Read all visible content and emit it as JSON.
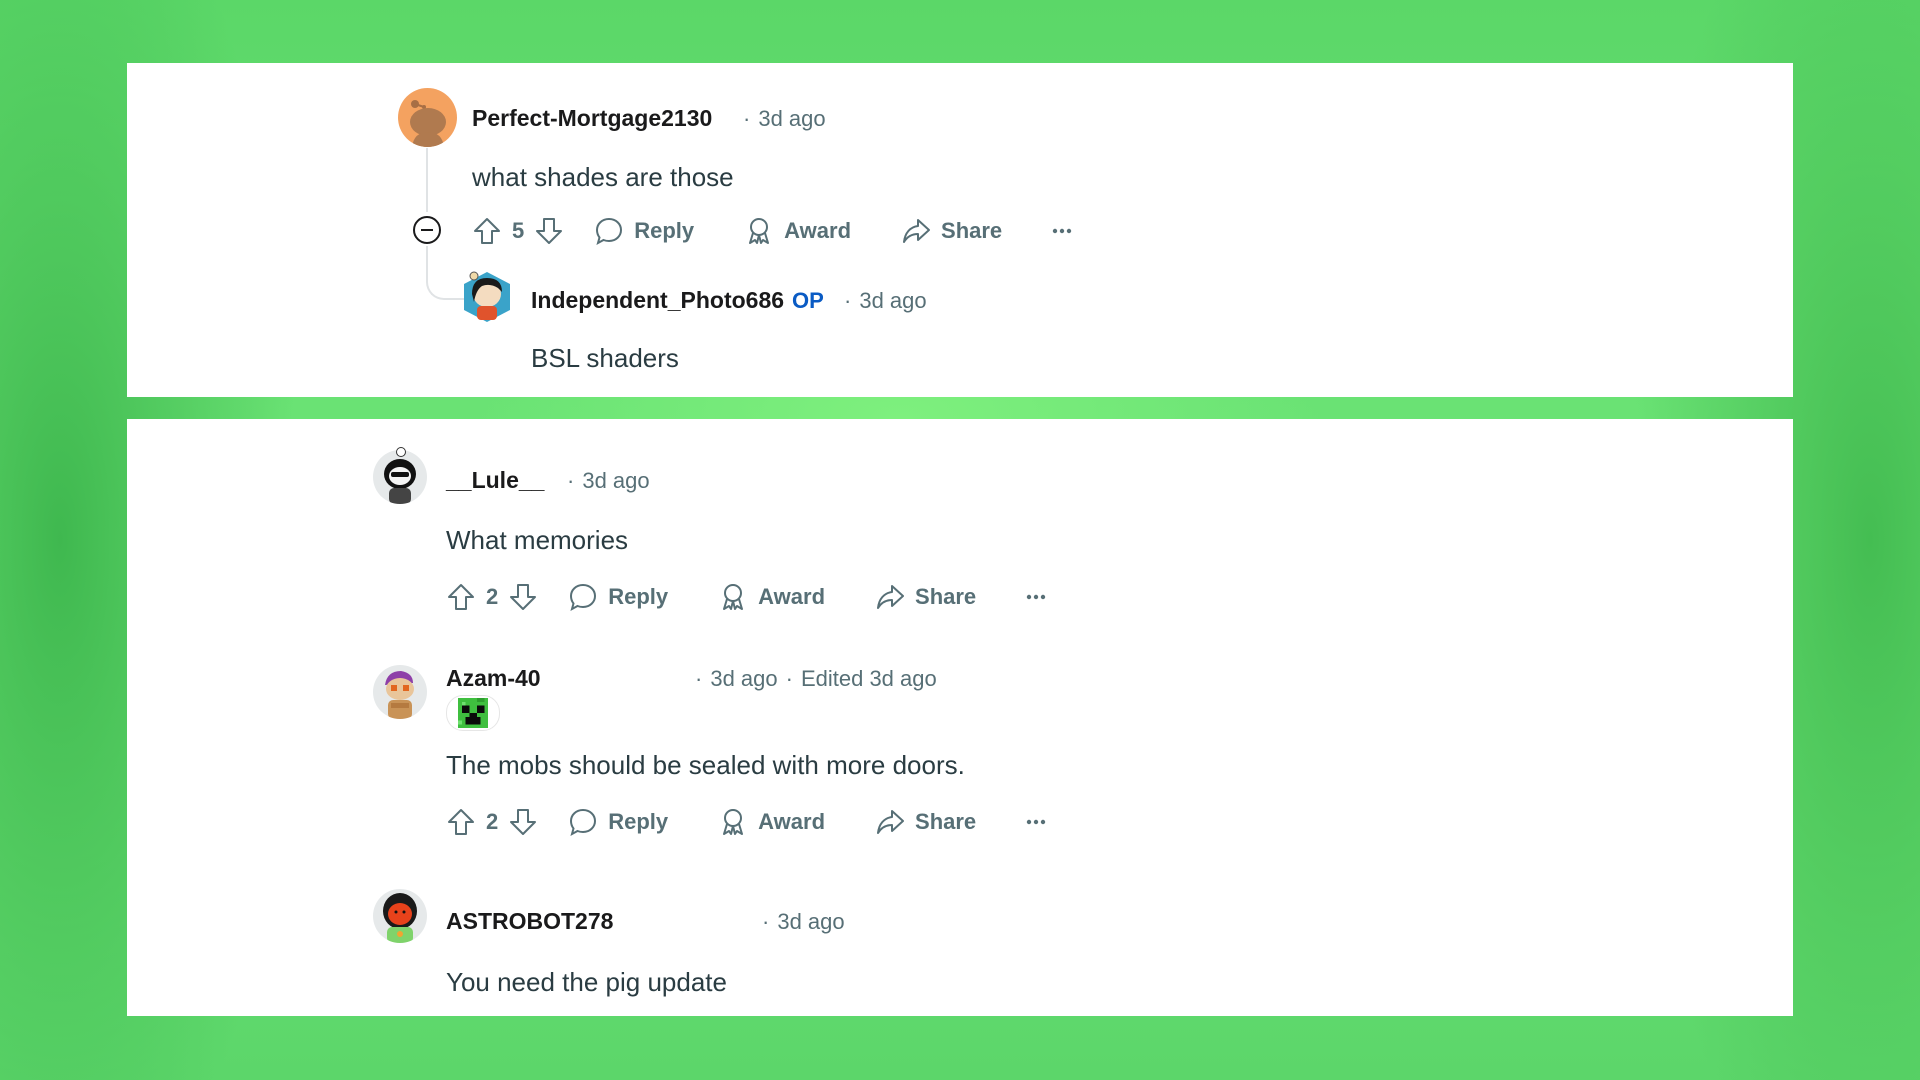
{
  "panels": [
    {
      "comments": [
        {
          "username": "Perfect-Mortgage2130",
          "time": "3d ago",
          "body": "what shades are those",
          "votes": "5",
          "actions": {
            "reply": "Reply",
            "award": "Award",
            "share": "Share"
          },
          "collapse_icon": "collapse-minus-icon",
          "replies": [
            {
              "username": "Independent_Photo686",
              "badge": "OP",
              "time": "3d ago",
              "body": "BSL shaders"
            }
          ]
        }
      ]
    },
    {
      "comments": [
        {
          "username": "__Lule__",
          "time": "3d ago",
          "body": "What memories",
          "votes": "2",
          "actions": {
            "reply": "Reply",
            "award": "Award",
            "share": "Share"
          }
        },
        {
          "username": "Azam-40",
          "time": "3d ago",
          "edited": "Edited 3d ago",
          "flair_icon": "creeper-face-icon",
          "body": "The mobs should be sealed with more doors.",
          "votes": "2",
          "actions": {
            "reply": "Reply",
            "award": "Award",
            "share": "Share"
          }
        },
        {
          "username": "ASTROBOT278",
          "time": "3d ago",
          "body": "You need the pig update"
        }
      ]
    }
  ],
  "separator": "·",
  "colors": {
    "background_green": "#6fe678",
    "op_badge": "#0a5bc4",
    "meta_text": "#576f76"
  }
}
